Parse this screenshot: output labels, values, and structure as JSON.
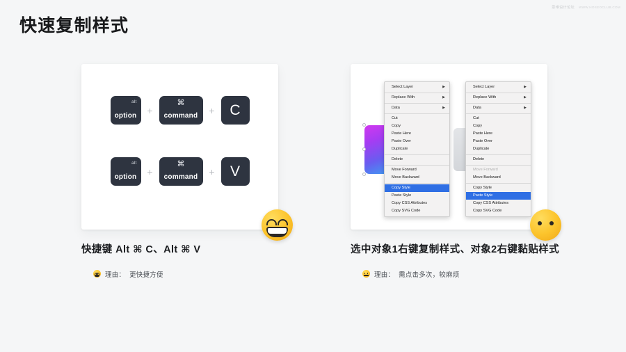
{
  "watermark": {
    "site": "思维设计论坛",
    "url": "WWW.HOSEOCLUB.COM"
  },
  "title": "快速复制样式",
  "columns": [
    {
      "id": "shortcut",
      "caption": "快捷键 Alt ⌘ C、Alt ⌘ V",
      "reason_label": "理由：",
      "reason_text": "更快捷方便",
      "reason_emoji": "grinning-face",
      "badge_emoji": "grinning-face-with-smiling-eyes",
      "shortcut_rows": [
        {
          "keys": [
            {
              "type": "dual",
              "sub": "alt",
              "main": "option"
            },
            {
              "type": "glyph",
              "glyph": "⌘",
              "main": "command"
            },
            {
              "type": "letter",
              "letter": "C"
            }
          ],
          "separator": "+"
        },
        {
          "keys": [
            {
              "type": "dual",
              "sub": "alt",
              "main": "option"
            },
            {
              "type": "glyph",
              "glyph": "⌘",
              "main": "command"
            },
            {
              "type": "letter",
              "letter": "V"
            }
          ],
          "separator": "+"
        }
      ]
    },
    {
      "id": "context-menu",
      "caption": "选中对象1右键复制样式、对象2右键黏贴样式",
      "reason_label": "理由：",
      "reason_text": "需点击多次，较麻烦",
      "reason_emoji": "expressionless-face",
      "badge_emoji": "expressionless-face",
      "menus": [
        {
          "name": "copy-style-menu",
          "items": [
            {
              "label": "Select Layer",
              "submenu": true
            },
            {
              "separator": true
            },
            {
              "label": "Replace With",
              "submenu": true
            },
            {
              "separator": true
            },
            {
              "label": "Data",
              "submenu": true
            },
            {
              "separator": true
            },
            {
              "label": "Cut"
            },
            {
              "label": "Copy"
            },
            {
              "label": "Paste Here"
            },
            {
              "label": "Paste Over"
            },
            {
              "label": "Duplicate"
            },
            {
              "separator": true
            },
            {
              "label": "Delete"
            },
            {
              "separator": true
            },
            {
              "label": "Move Forward"
            },
            {
              "label": "Move Backward"
            },
            {
              "separator": true
            },
            {
              "label": "Copy Style",
              "selected": true
            },
            {
              "label": "Paste Style"
            },
            {
              "label": "Copy CSS Attributes"
            },
            {
              "label": "Copy SVG Code"
            }
          ]
        },
        {
          "name": "paste-style-menu",
          "items": [
            {
              "label": "Select Layer",
              "submenu": true
            },
            {
              "separator": true
            },
            {
              "label": "Replace With",
              "submenu": true
            },
            {
              "separator": true
            },
            {
              "label": "Data",
              "submenu": true
            },
            {
              "separator": true
            },
            {
              "label": "Cut"
            },
            {
              "label": "Copy"
            },
            {
              "label": "Paste Here"
            },
            {
              "label": "Paste Over"
            },
            {
              "label": "Duplicate"
            },
            {
              "separator": true
            },
            {
              "label": "Delete"
            },
            {
              "separator": true
            },
            {
              "label": "Move Forward",
              "disabled": true
            },
            {
              "label": "Move Backward"
            },
            {
              "separator": true
            },
            {
              "label": "Copy Style"
            },
            {
              "label": "Paste Style",
              "selected": true
            },
            {
              "label": "Copy CSS Attributes"
            },
            {
              "label": "Copy SVG Code"
            }
          ]
        }
      ],
      "shapes": [
        {
          "name": "gradient-rectangle",
          "colors": [
            "#d138f0",
            "#6a5cf0",
            "#3d9ef2"
          ],
          "selected": true
        },
        {
          "name": "gray-rectangle",
          "colors": [
            "#e3e5e8",
            "#d3d6da"
          ],
          "selected": false
        }
      ]
    }
  ],
  "colors": {
    "background": "#f5f6f7",
    "card": "#ffffff",
    "key": "#2e3440",
    "menu_highlight": "#2f6fe4",
    "title": "#18191b"
  },
  "submenu_arrow": "▶"
}
